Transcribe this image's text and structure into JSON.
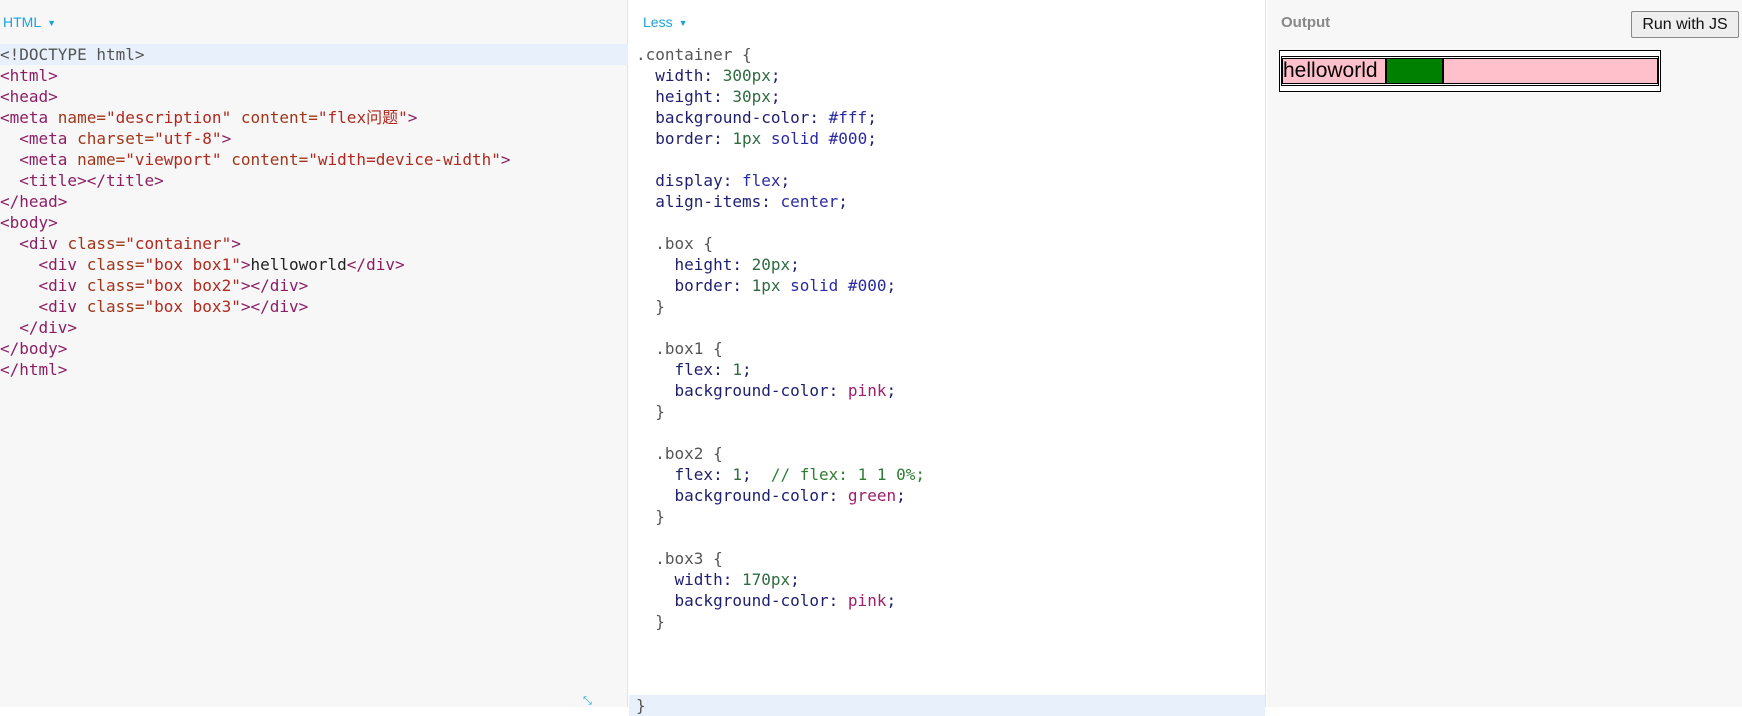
{
  "html_pane": {
    "label": "HTML",
    "caret": "▼"
  },
  "less_pane": {
    "label": "Less",
    "caret": "▼"
  },
  "output_pane": {
    "title": "Output",
    "run_button": "Run with JS"
  },
  "html_code": [
    [
      {
        "t": "<!DOCTYPE html>",
        "c": "meta"
      }
    ],
    [
      {
        "t": "<html>",
        "c": "tag"
      }
    ],
    [
      {
        "t": "<head>",
        "c": "tag"
      }
    ],
    [
      {
        "t": "<meta ",
        "c": "tag"
      },
      {
        "t": "name=",
        "c": "attr"
      },
      {
        "t": "\"description\"",
        "c": "str"
      },
      {
        "t": " content=",
        "c": "attr"
      },
      {
        "t": "\"flex问题\"",
        "c": "str"
      },
      {
        "t": ">",
        "c": "tag"
      }
    ],
    [
      {
        "t": "  <meta ",
        "c": "tag"
      },
      {
        "t": "charset=",
        "c": "attr"
      },
      {
        "t": "\"utf-8\"",
        "c": "str"
      },
      {
        "t": ">",
        "c": "tag"
      }
    ],
    [
      {
        "t": "  <meta ",
        "c": "tag"
      },
      {
        "t": "name=",
        "c": "attr"
      },
      {
        "t": "\"viewport\"",
        "c": "str"
      },
      {
        "t": " content=",
        "c": "attr"
      },
      {
        "t": "\"width=device-width\"",
        "c": "str"
      },
      {
        "t": ">",
        "c": "tag"
      }
    ],
    [
      {
        "t": "  <title></title>",
        "c": "tag"
      }
    ],
    [
      {
        "t": "</head>",
        "c": "tag"
      }
    ],
    [
      {
        "t": "<body>",
        "c": "tag"
      }
    ],
    [
      {
        "t": "  <div ",
        "c": "tag"
      },
      {
        "t": "class=",
        "c": "attr"
      },
      {
        "t": "\"container\"",
        "c": "str"
      },
      {
        "t": ">",
        "c": "tag"
      }
    ],
    [
      {
        "t": "    <div ",
        "c": "tag"
      },
      {
        "t": "class=",
        "c": "attr"
      },
      {
        "t": "\"box box1\"",
        "c": "str"
      },
      {
        "t": ">",
        "c": "tag"
      },
      {
        "t": "helloworld",
        "c": "txt"
      },
      {
        "t": "</div>",
        "c": "tag"
      }
    ],
    [
      {
        "t": "    <div ",
        "c": "tag"
      },
      {
        "t": "class=",
        "c": "attr"
      },
      {
        "t": "\"box box2\"",
        "c": "str"
      },
      {
        "t": "></div>",
        "c": "tag"
      }
    ],
    [
      {
        "t": "    <div ",
        "c": "tag"
      },
      {
        "t": "class=",
        "c": "attr"
      },
      {
        "t": "\"box box3\"",
        "c": "str"
      },
      {
        "t": "></div>",
        "c": "tag"
      }
    ],
    [
      {
        "t": "  </div>",
        "c": "tag"
      }
    ],
    [
      {
        "t": "</body>",
        "c": "tag"
      }
    ],
    [
      {
        "t": "</html>",
        "c": "tag"
      }
    ]
  ],
  "less_code": [
    [
      {
        "t": ".container {",
        "c": "sel"
      }
    ],
    [
      {
        "t": "  width: ",
        "c": "prop"
      },
      {
        "t": "300px",
        "c": "num"
      },
      {
        "t": ";",
        "c": "prop"
      }
    ],
    [
      {
        "t": "  height: ",
        "c": "prop"
      },
      {
        "t": "30px",
        "c": "num"
      },
      {
        "t": ";",
        "c": "prop"
      }
    ],
    [
      {
        "t": "  background-color: ",
        "c": "prop"
      },
      {
        "t": "#fff",
        "c": "kw"
      },
      {
        "t": ";",
        "c": "prop"
      }
    ],
    [
      {
        "t": "  border: ",
        "c": "prop"
      },
      {
        "t": "1px",
        "c": "num"
      },
      {
        "t": " solid #000",
        "c": "kw"
      },
      {
        "t": ";",
        "c": "prop"
      }
    ],
    [],
    [
      {
        "t": "  display: ",
        "c": "prop"
      },
      {
        "t": "flex",
        "c": "kw"
      },
      {
        "t": ";",
        "c": "prop"
      }
    ],
    [
      {
        "t": "  align-items: ",
        "c": "prop"
      },
      {
        "t": "center",
        "c": "kw"
      },
      {
        "t": ";",
        "c": "prop"
      }
    ],
    [],
    [
      {
        "t": "  .box {",
        "c": "sel"
      }
    ],
    [
      {
        "t": "    height: ",
        "c": "prop"
      },
      {
        "t": "20px",
        "c": "num"
      },
      {
        "t": ";",
        "c": "prop"
      }
    ],
    [
      {
        "t": "    border: ",
        "c": "prop"
      },
      {
        "t": "1px",
        "c": "num"
      },
      {
        "t": " solid #000",
        "c": "kw"
      },
      {
        "t": ";",
        "c": "prop"
      }
    ],
    [
      {
        "t": "  }",
        "c": "sel"
      }
    ],
    [],
    [
      {
        "t": "  .box1 {",
        "c": "sel"
      }
    ],
    [
      {
        "t": "    flex: ",
        "c": "prop"
      },
      {
        "t": "1",
        "c": "num"
      },
      {
        "t": ";",
        "c": "prop"
      }
    ],
    [
      {
        "t": "    background-color: ",
        "c": "prop"
      },
      {
        "t": "pink",
        "c": "col"
      },
      {
        "t": ";",
        "c": "prop"
      }
    ],
    [
      {
        "t": "  }",
        "c": "sel"
      }
    ],
    [],
    [
      {
        "t": "  .box2 {",
        "c": "sel"
      }
    ],
    [
      {
        "t": "    flex: ",
        "c": "prop"
      },
      {
        "t": "1",
        "c": "num"
      },
      {
        "t": ";  ",
        "c": "prop"
      },
      {
        "t": "// flex: 1 1 0%;",
        "c": "com"
      }
    ],
    [
      {
        "t": "    background-color: ",
        "c": "prop"
      },
      {
        "t": "green",
        "c": "col"
      },
      {
        "t": ";",
        "c": "prop"
      }
    ],
    [
      {
        "t": "  }",
        "c": "sel"
      }
    ],
    [],
    [
      {
        "t": "  .box3 {",
        "c": "sel"
      }
    ],
    [
      {
        "t": "    width: ",
        "c": "prop"
      },
      {
        "t": "170px",
        "c": "num"
      },
      {
        "t": ";",
        "c": "prop"
      }
    ],
    [
      {
        "t": "    background-color: ",
        "c": "prop"
      },
      {
        "t": "pink",
        "c": "col"
      },
      {
        "t": ";",
        "c": "prop"
      }
    ],
    [
      {
        "t": "  }",
        "c": "sel"
      }
    ],
    [],
    [],
    [],
    [
      {
        "t": "}",
        "c": "sel"
      }
    ]
  ],
  "output": {
    "box1_text": "helloworld"
  },
  "colors": {
    "accent": "#1aa3d9",
    "box_pink": "pink",
    "box_green": "green"
  }
}
